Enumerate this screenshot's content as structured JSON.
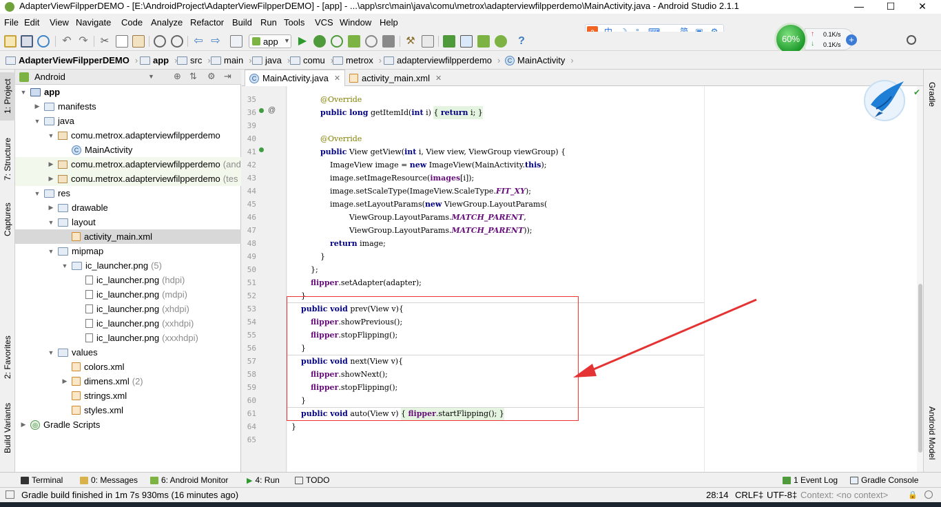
{
  "window": {
    "title": "AdapterViewFilpperDEMO - [E:\\AndroidProject\\AdapterViewFilpperDEMO] - [app] - ...\\app\\src\\main\\java\\comu\\metrox\\adapterviewfilpperdemo\\MainActivity.java - Android Studio 2.1.1",
    "controls": [
      "—",
      "☐",
      "✕"
    ]
  },
  "menu": [
    "File",
    "Edit",
    "View",
    "Navigate",
    "Code",
    "Analyze",
    "Refactor",
    "Build",
    "Run",
    "Tools",
    "VCS",
    "Window",
    "Help"
  ],
  "toolbar": {
    "run_config": "app"
  },
  "ime": [
    "中",
    "☽",
    "°,",
    "⌨",
    "◡",
    "简",
    "▣",
    "⚙"
  ],
  "net": {
    "percent": "60%",
    "up": "0.1K/s",
    "down": "0.1K/s"
  },
  "breadcrumb": [
    "AdapterViewFilpperDEMO",
    "app",
    "src",
    "main",
    "java",
    "comu",
    "metrox",
    "adapterviewfilpperdemo",
    "MainActivity"
  ],
  "left_tabs": [
    "1: Project",
    "7: Structure",
    "Captures",
    "2: Favorites",
    "Build Variants"
  ],
  "right_tabs": [
    "Gradle",
    "Android Model"
  ],
  "project": {
    "view": "Android",
    "tree": [
      {
        "indent": 0,
        "arrow": "▼",
        "icon": "module",
        "label": "app",
        "bold": true
      },
      {
        "indent": 1,
        "arrow": "▶",
        "icon": "folder",
        "label": "manifests"
      },
      {
        "indent": 1,
        "arrow": "▼",
        "icon": "folder",
        "label": "java"
      },
      {
        "indent": 2,
        "arrow": "▼",
        "icon": "package",
        "label": "comu.metrox.adapterviewfilpperdemo"
      },
      {
        "indent": 3,
        "arrow": "",
        "icon": "class",
        "label": "MainActivity"
      },
      {
        "indent": 2,
        "arrow": "▶",
        "icon": "package",
        "label": "comu.metrox.adapterviewfilpperdemo",
        "dim": "(and",
        "hl": true
      },
      {
        "indent": 2,
        "arrow": "▶",
        "icon": "package",
        "label": "comu.metrox.adapterviewfilpperdemo",
        "dim": "(tes",
        "hl": true
      },
      {
        "indent": 1,
        "arrow": "▼",
        "icon": "folder",
        "label": "res"
      },
      {
        "indent": 2,
        "arrow": "▶",
        "icon": "folder",
        "label": "drawable"
      },
      {
        "indent": 2,
        "arrow": "▼",
        "icon": "folder",
        "label": "layout"
      },
      {
        "indent": 3,
        "arrow": "",
        "icon": "xml",
        "label": "activity_main.xml",
        "sel": true
      },
      {
        "indent": 2,
        "arrow": "▼",
        "icon": "folder",
        "label": "mipmap"
      },
      {
        "indent": 3,
        "arrow": "▼",
        "icon": "folder",
        "label": "ic_launcher.png",
        "dim": "(5)"
      },
      {
        "indent": 4,
        "arrow": "",
        "icon": "png",
        "label": "ic_launcher.png",
        "dim": "(hdpi)"
      },
      {
        "indent": 4,
        "arrow": "",
        "icon": "png",
        "label": "ic_launcher.png",
        "dim": "(mdpi)"
      },
      {
        "indent": 4,
        "arrow": "",
        "icon": "png",
        "label": "ic_launcher.png",
        "dim": "(xhdpi)"
      },
      {
        "indent": 4,
        "arrow": "",
        "icon": "png",
        "label": "ic_launcher.png",
        "dim": "(xxhdpi)"
      },
      {
        "indent": 4,
        "arrow": "",
        "icon": "png",
        "label": "ic_launcher.png",
        "dim": "(xxxhdpi)"
      },
      {
        "indent": 2,
        "arrow": "▼",
        "icon": "folder",
        "label": "values"
      },
      {
        "indent": 3,
        "arrow": "",
        "icon": "xml",
        "label": "colors.xml"
      },
      {
        "indent": 3,
        "arrow": "▶",
        "icon": "xml",
        "label": "dimens.xml",
        "dim": "(2)"
      },
      {
        "indent": 3,
        "arrow": "",
        "icon": "xml",
        "label": "strings.xml"
      },
      {
        "indent": 3,
        "arrow": "",
        "icon": "xml",
        "label": "styles.xml"
      },
      {
        "indent": 0,
        "arrow": "▶",
        "icon": "gradle",
        "label": "Gradle Scripts"
      }
    ]
  },
  "editor": {
    "tabs": [
      {
        "label": "MainActivity.java",
        "active": true,
        "icon": "C"
      },
      {
        "label": "activity_main.xml",
        "active": false,
        "icon": "xml"
      }
    ],
    "lines": [
      {
        "n": "35",
        "code": "            <a>@Override</a>"
      },
      {
        "n": "36",
        "code": "            <k>public long</k> getItemId(<k>int</k> i) <m>{ <k>return</k> i; }</m>"
      },
      {
        "n": "39",
        "code": ""
      },
      {
        "n": "40",
        "code": "            <a>@Override</a>"
      },
      {
        "n": "41",
        "code": "            <k>public</k> View getView(<k>int</k> i, View view, ViewGroup viewGroup) {"
      },
      {
        "n": "42",
        "code": "                ImageView image = <k>new</k> ImageView(MainActivity.<k>this</k>);"
      },
      {
        "n": "43",
        "code": "                image.setImageResource(<f>images</f>[i]);"
      },
      {
        "n": "44",
        "code": "                image.setScaleType(ImageView.ScaleType.<s>FIT_XY</s>);"
      },
      {
        "n": "45",
        "code": "                image.setLayoutParams(<k>new</k> ViewGroup.LayoutParams("
      },
      {
        "n": "46",
        "code": "                        ViewGroup.LayoutParams.<s>MATCH_PARENT</s>,"
      },
      {
        "n": "47",
        "code": "                        ViewGroup.LayoutParams.<s>MATCH_PARENT</s>));"
      },
      {
        "n": "48",
        "code": "                <k>return</k> image;"
      },
      {
        "n": "49",
        "code": "            }"
      },
      {
        "n": "50",
        "code": "        };"
      },
      {
        "n": "51",
        "code": "        <f>flipper</f>.setAdapter(adapter);"
      },
      {
        "n": "52",
        "code": "    }"
      },
      {
        "n": "53",
        "code": "    <k>public void</k> prev(View v){"
      },
      {
        "n": "54",
        "code": "        <f>flipper</f>.showPrevious();"
      },
      {
        "n": "55",
        "code": "        <f>flipper</f>.stopFlipping();"
      },
      {
        "n": "56",
        "code": "    }"
      },
      {
        "n": "57",
        "code": "    <k>public void</k> next(View v){"
      },
      {
        "n": "58",
        "code": "        <f>flipper</f>.showNext();"
      },
      {
        "n": "59",
        "code": "        <f>flipper</f>.stopFlipping();"
      },
      {
        "n": "60",
        "code": "    }"
      },
      {
        "n": "61",
        "code": "    <k>public void</k> auto(View v) <m>{ <f>flipper</f>.startFlipping(); }</m>"
      },
      {
        "n": "64",
        "code": "}"
      },
      {
        "n": "65",
        "code": ""
      }
    ]
  },
  "bottom_tabs": [
    {
      "label": "Terminal",
      "icon": "terminal"
    },
    {
      "label": "0: Messages",
      "icon": "messages"
    },
    {
      "label": "6: Android Monitor",
      "icon": "android"
    },
    {
      "label": "4: Run",
      "icon": "run"
    },
    {
      "label": "TODO",
      "icon": "todo"
    },
    {
      "label": "1 Event Log",
      "icon": "eventlog"
    },
    {
      "label": "Gradle Console",
      "icon": "gradle"
    }
  ],
  "status": {
    "message": "Gradle build finished in 1m 7s 930ms (16 minutes ago)",
    "position": "28:14",
    "line_sep": "CRLF‡",
    "encoding": "UTF-8‡",
    "context": "Context: <no context>"
  },
  "colors": {
    "annotation_red": "#e53333",
    "keyword": "#000080",
    "field": "#660e7a",
    "annotation": "#808000"
  }
}
